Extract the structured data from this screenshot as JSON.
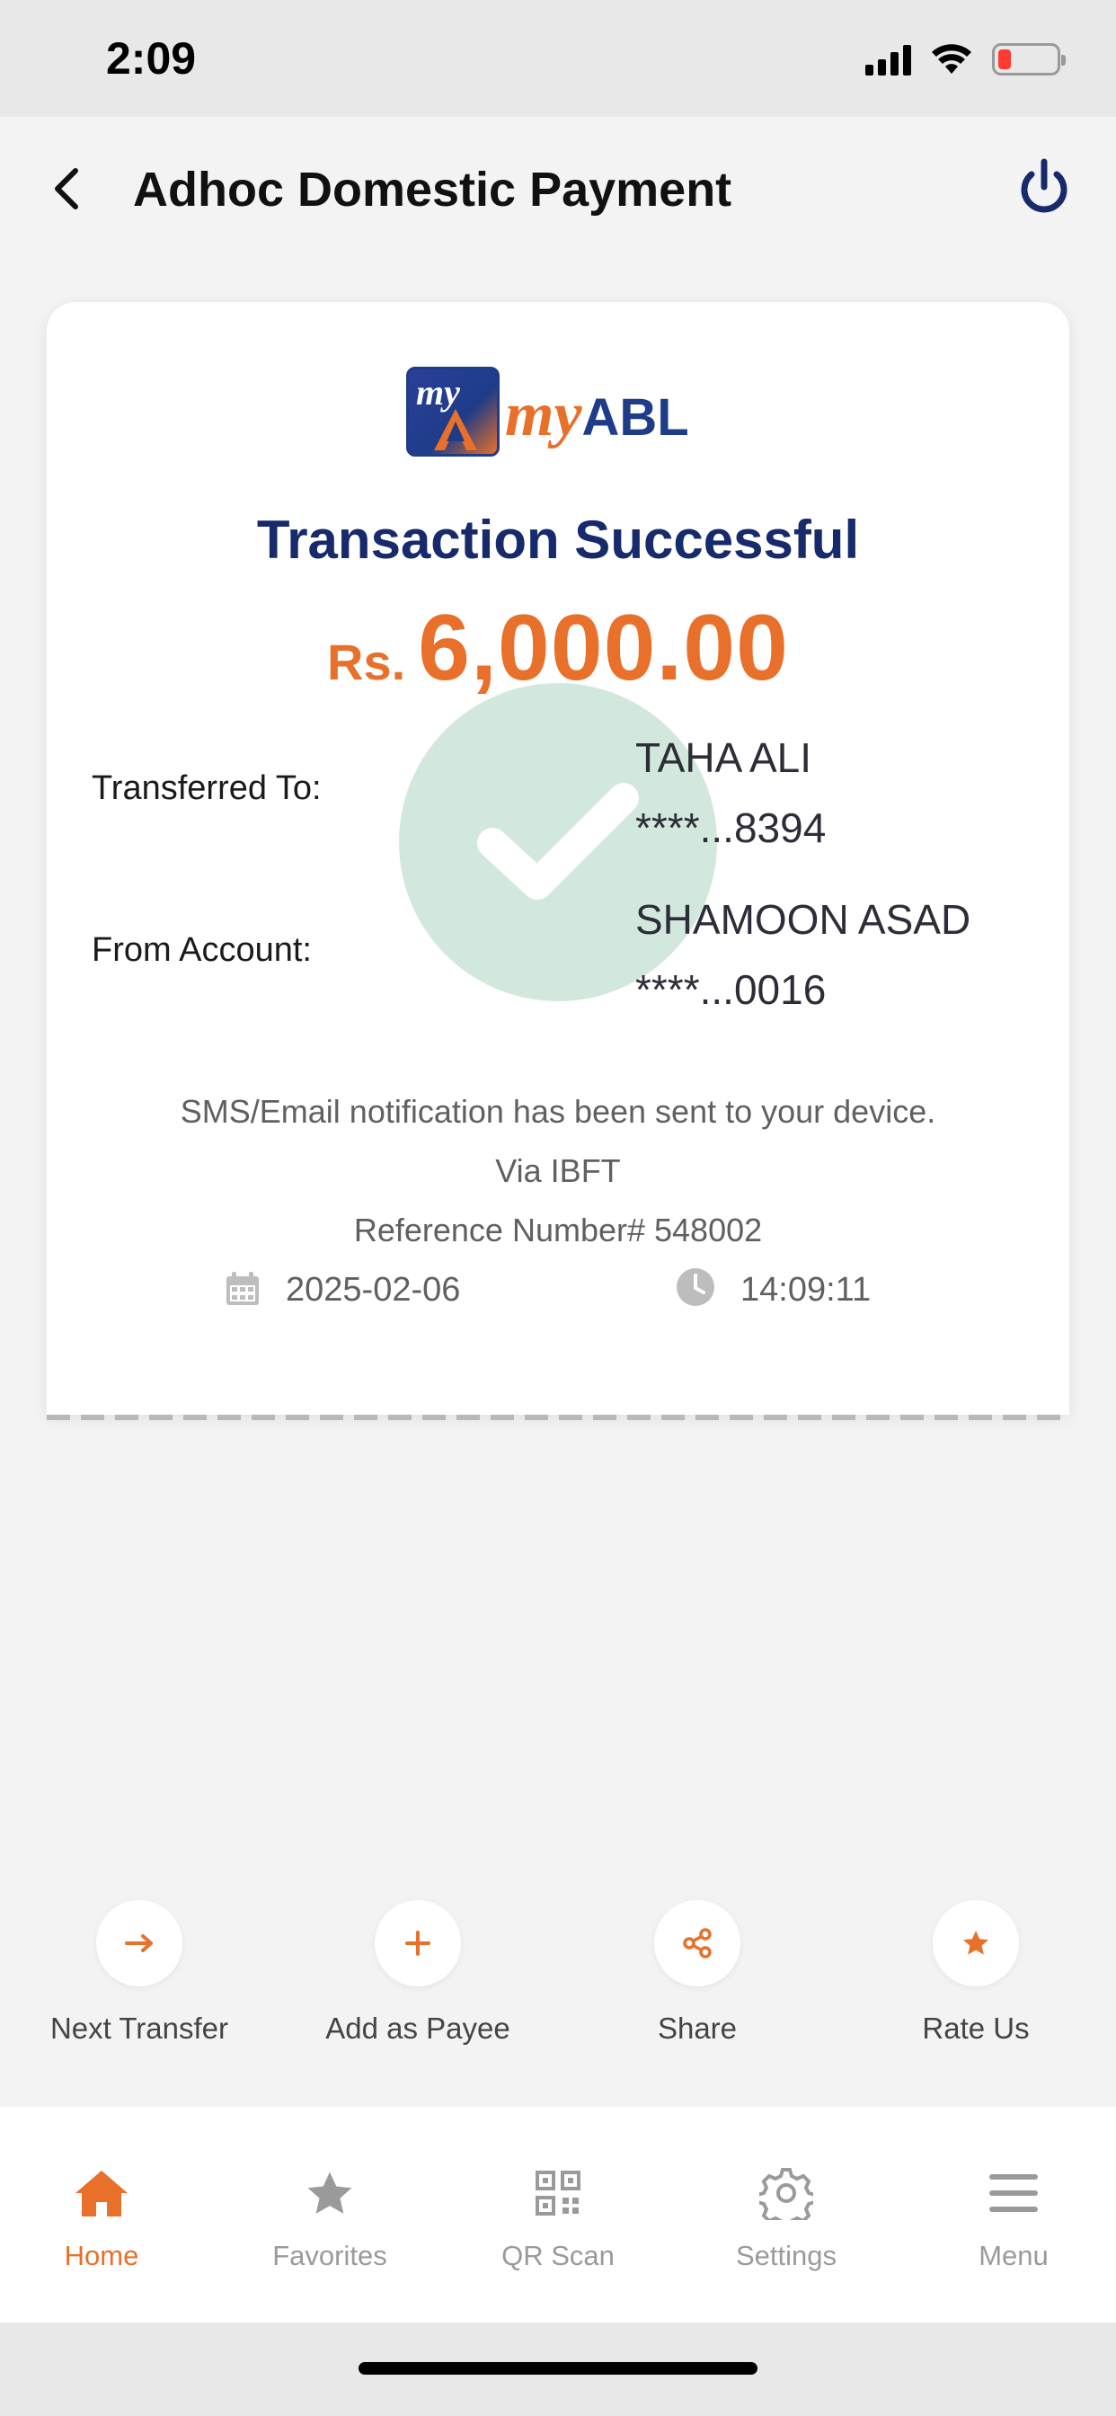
{
  "status_bar": {
    "time": "2:09"
  },
  "header": {
    "title": "Adhoc Domestic Payment"
  },
  "receipt": {
    "title": "Transaction Successful",
    "currency": "Rs.",
    "amount": "6,000.00",
    "transferred_to_label": "Transferred To:",
    "transferred_to_name": "TAHA ALI",
    "transferred_to_account": "****...8394",
    "from_account_label": "From Account:",
    "from_account_name": "SHAMOON ASAD",
    "from_account_number": "****...0016",
    "notification": "SMS/Email notification has been sent to your device.",
    "via": "Via IBFT",
    "reference": "Reference Number# 548002",
    "date": "2025-02-06",
    "time": "14:09:11"
  },
  "actions": [
    {
      "label": "Next Transfer",
      "icon": "arrow-right-icon"
    },
    {
      "label": "Add as Payee",
      "icon": "plus-icon"
    },
    {
      "label": "Share",
      "icon": "share-icon"
    },
    {
      "label": "Rate Us",
      "icon": "star-icon"
    }
  ],
  "nav": [
    {
      "label": "Home",
      "icon": "home-icon",
      "active": true
    },
    {
      "label": "Favorites",
      "icon": "star-icon"
    },
    {
      "label": "QR Scan",
      "icon": "qr-icon"
    },
    {
      "label": "Settings",
      "icon": "gear-icon"
    },
    {
      "label": "Menu",
      "icon": "menu-icon"
    }
  ],
  "colors": {
    "accent": "#e8702a",
    "brand": "#172a6b",
    "success_circle": "#d3e8dc"
  }
}
